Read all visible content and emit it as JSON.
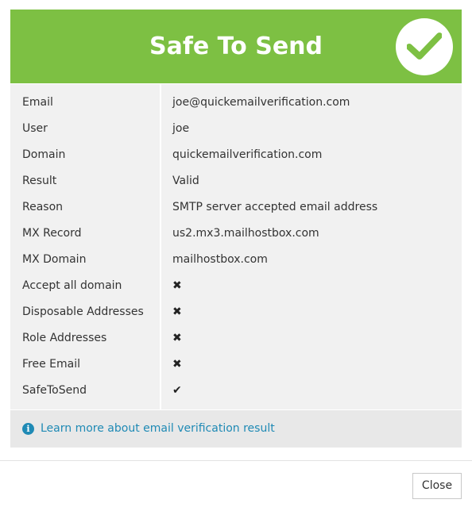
{
  "header": {
    "title": "Safe To Send",
    "badge_icon": "check-circle-icon",
    "background_color": "#7dc043"
  },
  "rows": [
    {
      "label": "Email",
      "value": "joe@quickemailverification.com"
    },
    {
      "label": "User",
      "value": "joe"
    },
    {
      "label": "Domain",
      "value": "quickemailverification.com"
    },
    {
      "label": "Result",
      "value": "Valid"
    },
    {
      "label": "Reason",
      "value": "SMTP server accepted email address"
    },
    {
      "label": "MX Record",
      "value": "us2.mx3.mailhostbox.com"
    },
    {
      "label": "MX Domain",
      "value": "mailhostbox.com"
    },
    {
      "label": "Accept all domain",
      "value": "✖",
      "icon": "cross-icon"
    },
    {
      "label": "Disposable Addresses",
      "value": "✖",
      "icon": "cross-icon"
    },
    {
      "label": "Role Addresses",
      "value": "✖",
      "icon": "cross-icon"
    },
    {
      "label": "Free Email",
      "value": "✖",
      "icon": "cross-icon"
    },
    {
      "label": "SafeToSend",
      "value": "✔",
      "icon": "check-icon"
    }
  ],
  "info": {
    "icon": "info-icon",
    "link_text": "Learn more about email verification result",
    "link_color": "#1f8ab5"
  },
  "footer": {
    "close_label": "Close"
  }
}
